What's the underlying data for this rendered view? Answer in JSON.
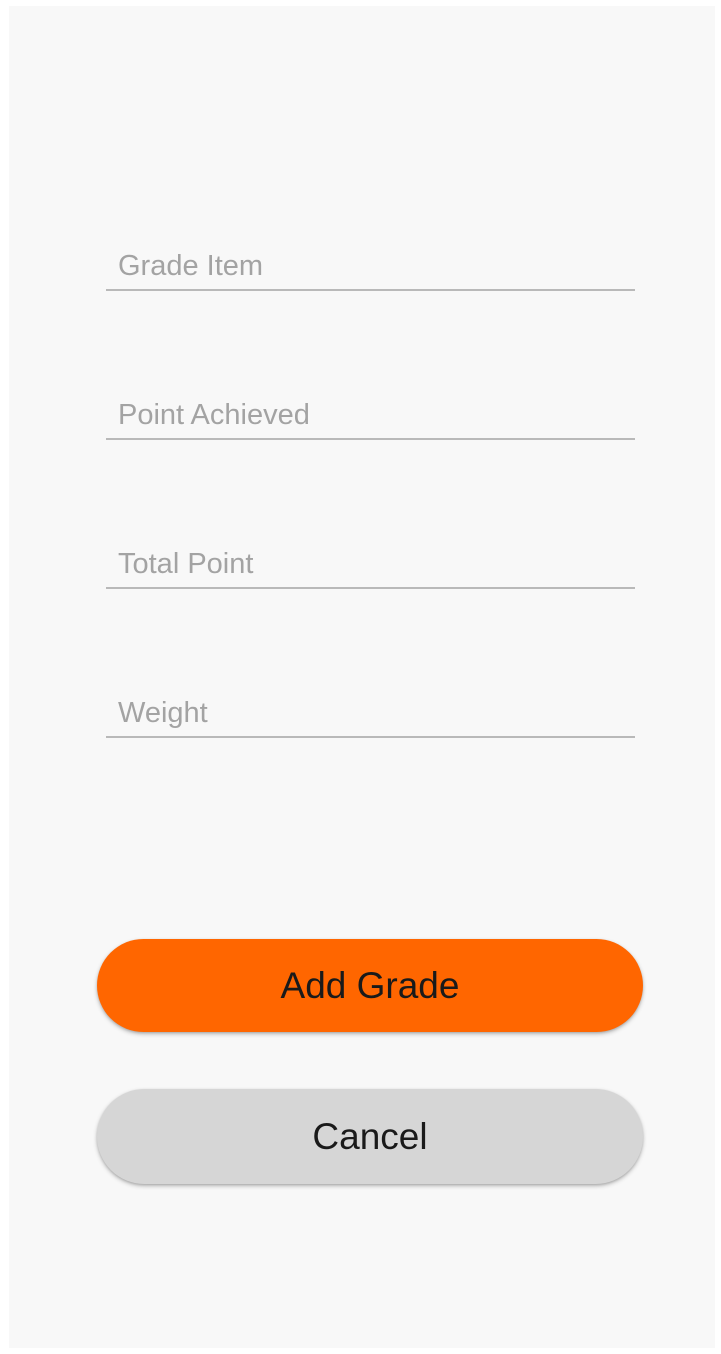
{
  "form": {
    "fields": [
      {
        "id": "grade-item",
        "value": "",
        "placeholder": "Grade Item"
      },
      {
        "id": "point-achieved",
        "value": "",
        "placeholder": "Point Achieved"
      },
      {
        "id": "total-point",
        "value": "",
        "placeholder": "Total Point"
      },
      {
        "id": "weight",
        "value": "",
        "placeholder": "Weight"
      }
    ],
    "add_label": "Add Grade",
    "cancel_label": "Cancel"
  },
  "colors": {
    "background": "#f8f8f8",
    "primary_button": "#ff6600",
    "secondary_button": "#d6d6d6",
    "field_underline": "#b9b9b9",
    "hint_text": "#a3a3a3"
  }
}
